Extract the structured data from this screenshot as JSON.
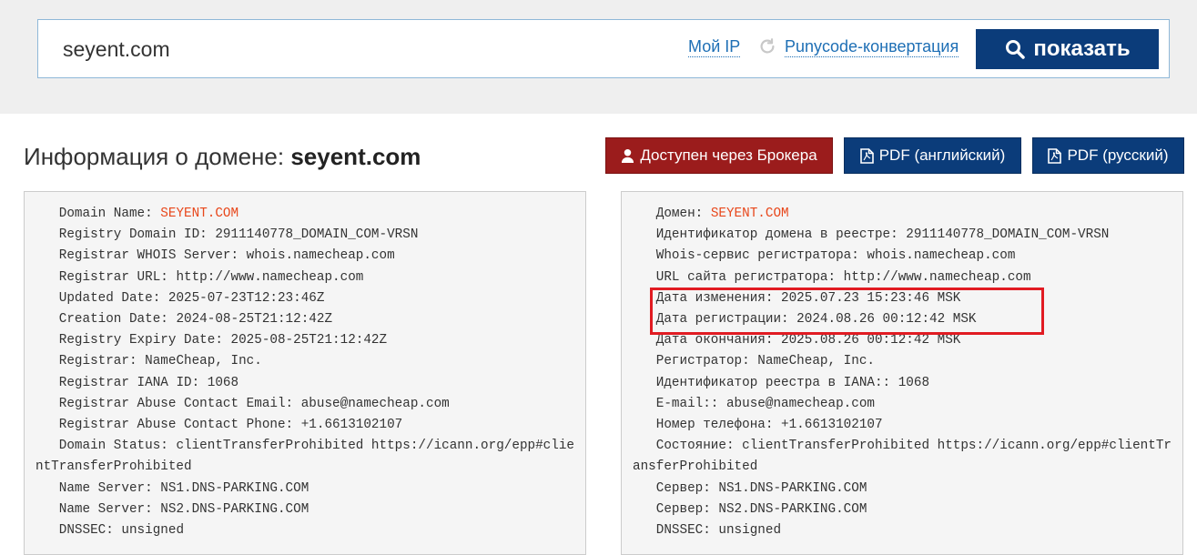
{
  "search": {
    "value": "seyent.com",
    "my_ip_label": "Мой IP",
    "punycode_label": "Punycode-конвертация",
    "show_label": "показать"
  },
  "header": {
    "title_prefix": "Информация о домене:",
    "title_domain": "seyent.com"
  },
  "actions": {
    "broker_label": "Доступен через Брокера",
    "pdf_en_label": "PDF (английский)",
    "pdf_ru_label": "PDF (русский)"
  },
  "colors": {
    "primary": "#0b3c7a",
    "broker": "#9b1c1c",
    "link": "#1e6fb5",
    "highlight_text": "#e8471b",
    "highlight_box": "#e11b22"
  },
  "whois_en": {
    "domain_name_key": "Domain Name: ",
    "domain_name_value": "SEYENT.COM",
    "lines": [
      "Registry Domain ID: 2911140778_DOMAIN_COM-VRSN",
      "Registrar WHOIS Server: whois.namecheap.com",
      "Registrar URL: http://www.namecheap.com",
      "Updated Date: 2025-07-23T12:23:46Z",
      "Creation Date: 2024-08-25T21:12:42Z",
      "Registry Expiry Date: 2025-08-25T21:12:42Z",
      "Registrar: NameCheap, Inc.",
      "Registrar IANA ID: 1068",
      "Registrar Abuse Contact Email: abuse@namecheap.com",
      "Registrar Abuse Contact Phone: +1.6613102107",
      "Domain Status: clientTransferProhibited https://icann.org/epp#clientTransferProhibited",
      "Name Server: NS1.DNS-PARKING.COM",
      "Name Server: NS2.DNS-PARKING.COM",
      "DNSSEC: unsigned"
    ]
  },
  "whois_ru": {
    "domain_name_key": "Домен: ",
    "domain_name_value": "SEYENT.COM",
    "lines": [
      "Идентификатор домена в реестре: 2911140778_DOMAIN_COM-VRSN",
      "Whois-сервис регистратора: whois.namecheap.com",
      "URL сайта регистратора: http://www.namecheap.com",
      "Дата изменения: 2025.07.23 15:23:46 MSK",
      "Дата регистрации: 2024.08.26 00:12:42 MSK",
      "Дата окончания: 2025.08.26 00:12:42 MSK",
      "Регистратор: NameCheap, Inc.",
      "Идентификатор реестра в IANA:: 1068",
      "E-mail:: abuse@namecheap.com",
      "Номер телефона: +1.6613102107",
      "Состояние: clientTransferProhibited https://icann.org/epp#clientTransferProhibited",
      "Сервер: NS1.DNS-PARKING.COM",
      "Сервер: NS2.DNS-PARKING.COM",
      "DNSSEC: unsigned"
    ]
  }
}
